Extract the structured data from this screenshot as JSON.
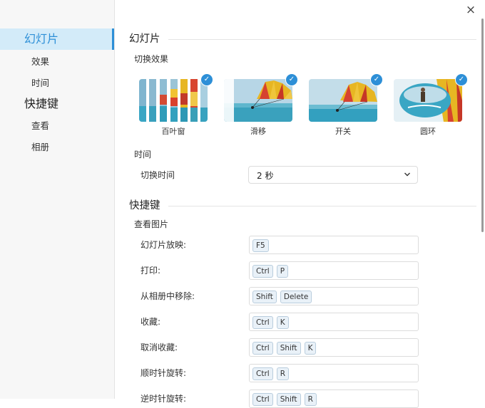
{
  "sidebar": {
    "items": [
      {
        "label": "幻灯片"
      },
      {
        "label": "效果"
      },
      {
        "label": "时间"
      },
      {
        "label": "快捷键"
      },
      {
        "label": "查看"
      },
      {
        "label": "相册"
      }
    ]
  },
  "window": {
    "close_label": "×"
  },
  "slideshow": {
    "title": "幻灯片",
    "effects_label": "切换效果",
    "effects": [
      {
        "label": "百叶窗",
        "checked": true
      },
      {
        "label": "滑移",
        "checked": true
      },
      {
        "label": "开关",
        "checked": true
      },
      {
        "label": "圆环",
        "checked": true
      }
    ],
    "check_glyph": "✓",
    "time_group": "时间",
    "time_row_label": "切换时间",
    "time_value": "2 秒"
  },
  "shortcuts": {
    "title": "快捷键",
    "view_group": "查看图片",
    "rows": [
      {
        "label": "幻灯片放映:",
        "keys": [
          "F5"
        ]
      },
      {
        "label": "打印:",
        "keys": [
          "Ctrl",
          "P"
        ]
      },
      {
        "label": "从相册中移除:",
        "keys": [
          "Shift",
          "Delete"
        ]
      },
      {
        "label": "收藏:",
        "keys": [
          "Ctrl",
          "K"
        ]
      },
      {
        "label": "取消收藏:",
        "keys": [
          "Ctrl",
          "Shift",
          "K"
        ]
      },
      {
        "label": "顺时针旋转:",
        "keys": [
          "Ctrl",
          "R"
        ]
      },
      {
        "label": "逆时针旋转:",
        "keys": [
          "Ctrl",
          "Shift",
          "R"
        ]
      }
    ]
  },
  "colors": {
    "accent": "#2d8fd7",
    "active_bg": "#d3ebf9"
  }
}
